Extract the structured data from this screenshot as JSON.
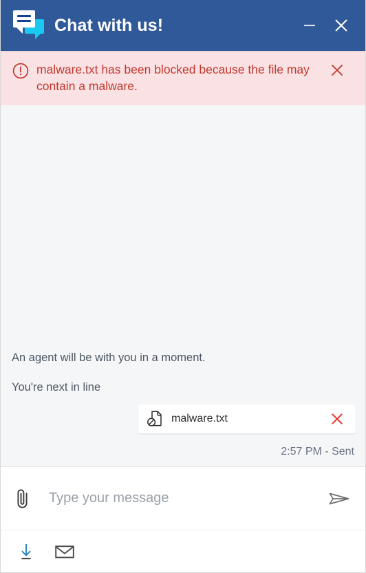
{
  "window": {
    "title": "Chat with us!",
    "logo_icon": "chat-bubbles-icon",
    "minimize_label": "Minimize",
    "close_label": "Close",
    "header_color": "#30599A",
    "accent_cyan": "#19C9F2"
  },
  "alert": {
    "icon": "exclamation-circle-icon",
    "message": "malware.txt has been blocked because the file may contain a malware.",
    "close_label": "Dismiss",
    "background_color": "#FAE1E3",
    "text_color": "#C0392F"
  },
  "conversation": {
    "messages": [
      {
        "text": "An agent will be with you in a moment."
      },
      {
        "text": "You're next in line"
      }
    ],
    "attachment": {
      "icon": "blocked-file-icon",
      "filename": "malware.txt",
      "remove_label": "Remove attachment",
      "remove_color": "#E8302A"
    },
    "status": "2:57 PM - Sent"
  },
  "composer": {
    "attach_icon": "paperclip-icon",
    "placeholder": "Type your message",
    "value": "",
    "send_icon": "send-plane-icon"
  },
  "toolbar": {
    "items": [
      {
        "icon": "download-icon",
        "label": "Download transcript",
        "color": "#1B7FB8"
      },
      {
        "icon": "envelope-icon",
        "label": "Email transcript",
        "color": "#4A4A4A"
      }
    ]
  }
}
